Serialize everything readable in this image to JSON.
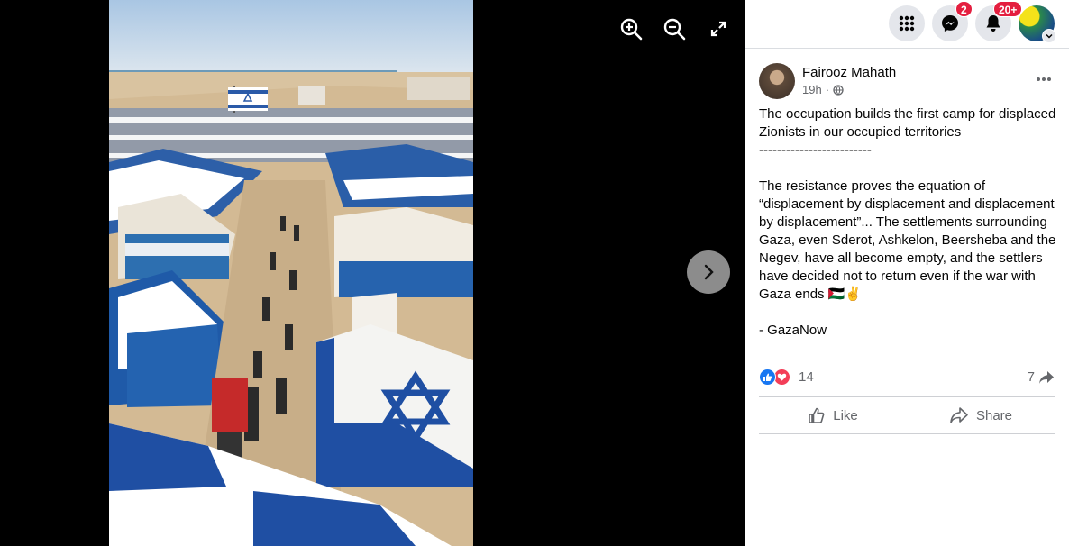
{
  "viewer": {
    "image_alt": "Rows of blue and white tents with Israeli flag on beach",
    "zoom_in_icon": "zoom-in-icon",
    "zoom_out_icon": "zoom-out-icon",
    "fullscreen_icon": "fullscreen-icon",
    "next_icon": "chevron-right-icon"
  },
  "topbar": {
    "menu_icon": "grid-menu-icon",
    "messenger_badge": "2",
    "notifications_badge": "20+"
  },
  "post": {
    "author": "Fairooz Mahath",
    "time": "19h",
    "audience_icon": "globe-icon",
    "text": [
      "The occupation builds the first camp for displaced Zionists in our occupied territories",
      "-------------------------",
      "",
      "The resistance proves the equation of “displacement by displacement and displacement by displacement”... The settlements surrounding Gaza, even Sderot, Ashkelon, Beersheba and the Negev, have all become empty, and the settlers have decided not to return even if the war with Gaza ends 🇵🇸✌",
      "",
      "- GazaNow"
    ],
    "reactions_count": "14",
    "shares_count": "7",
    "like_label": "Like",
    "share_label": "Share"
  },
  "colors": {
    "badge": "#e41e3f",
    "like_blue": "#1877f2",
    "love_red": "#f33e58",
    "flag_blue": "#1f4fa3"
  }
}
